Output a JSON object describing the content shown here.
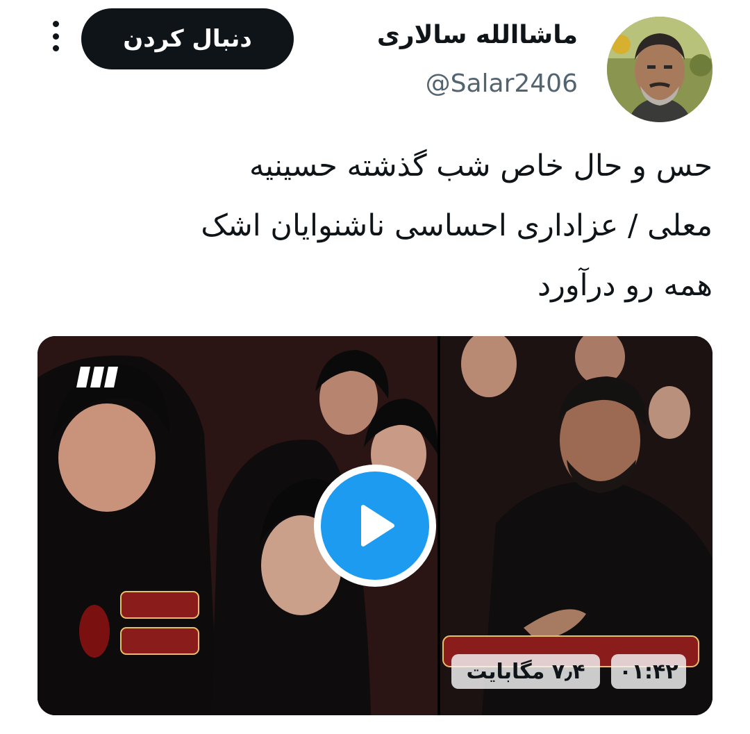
{
  "author": {
    "name": "ماشاالله سالاری",
    "handle": "@Salar2406"
  },
  "actions": {
    "follow_label": "دنبال کردن",
    "more_icon": "more-vertical-icon"
  },
  "tweet": {
    "lines": [
      "حس و حال خاص شب گذشته حسینیه",
      "معلی / عزاداری احساسی ناشنوایان اشک",
      "همه رو درآورد"
    ]
  },
  "media": {
    "size_label": "۷٫۴ مگابایت",
    "duration_label": "۰۱:۴۲",
    "play_icon": "play-icon",
    "accent_color": "#1d9bf0"
  }
}
